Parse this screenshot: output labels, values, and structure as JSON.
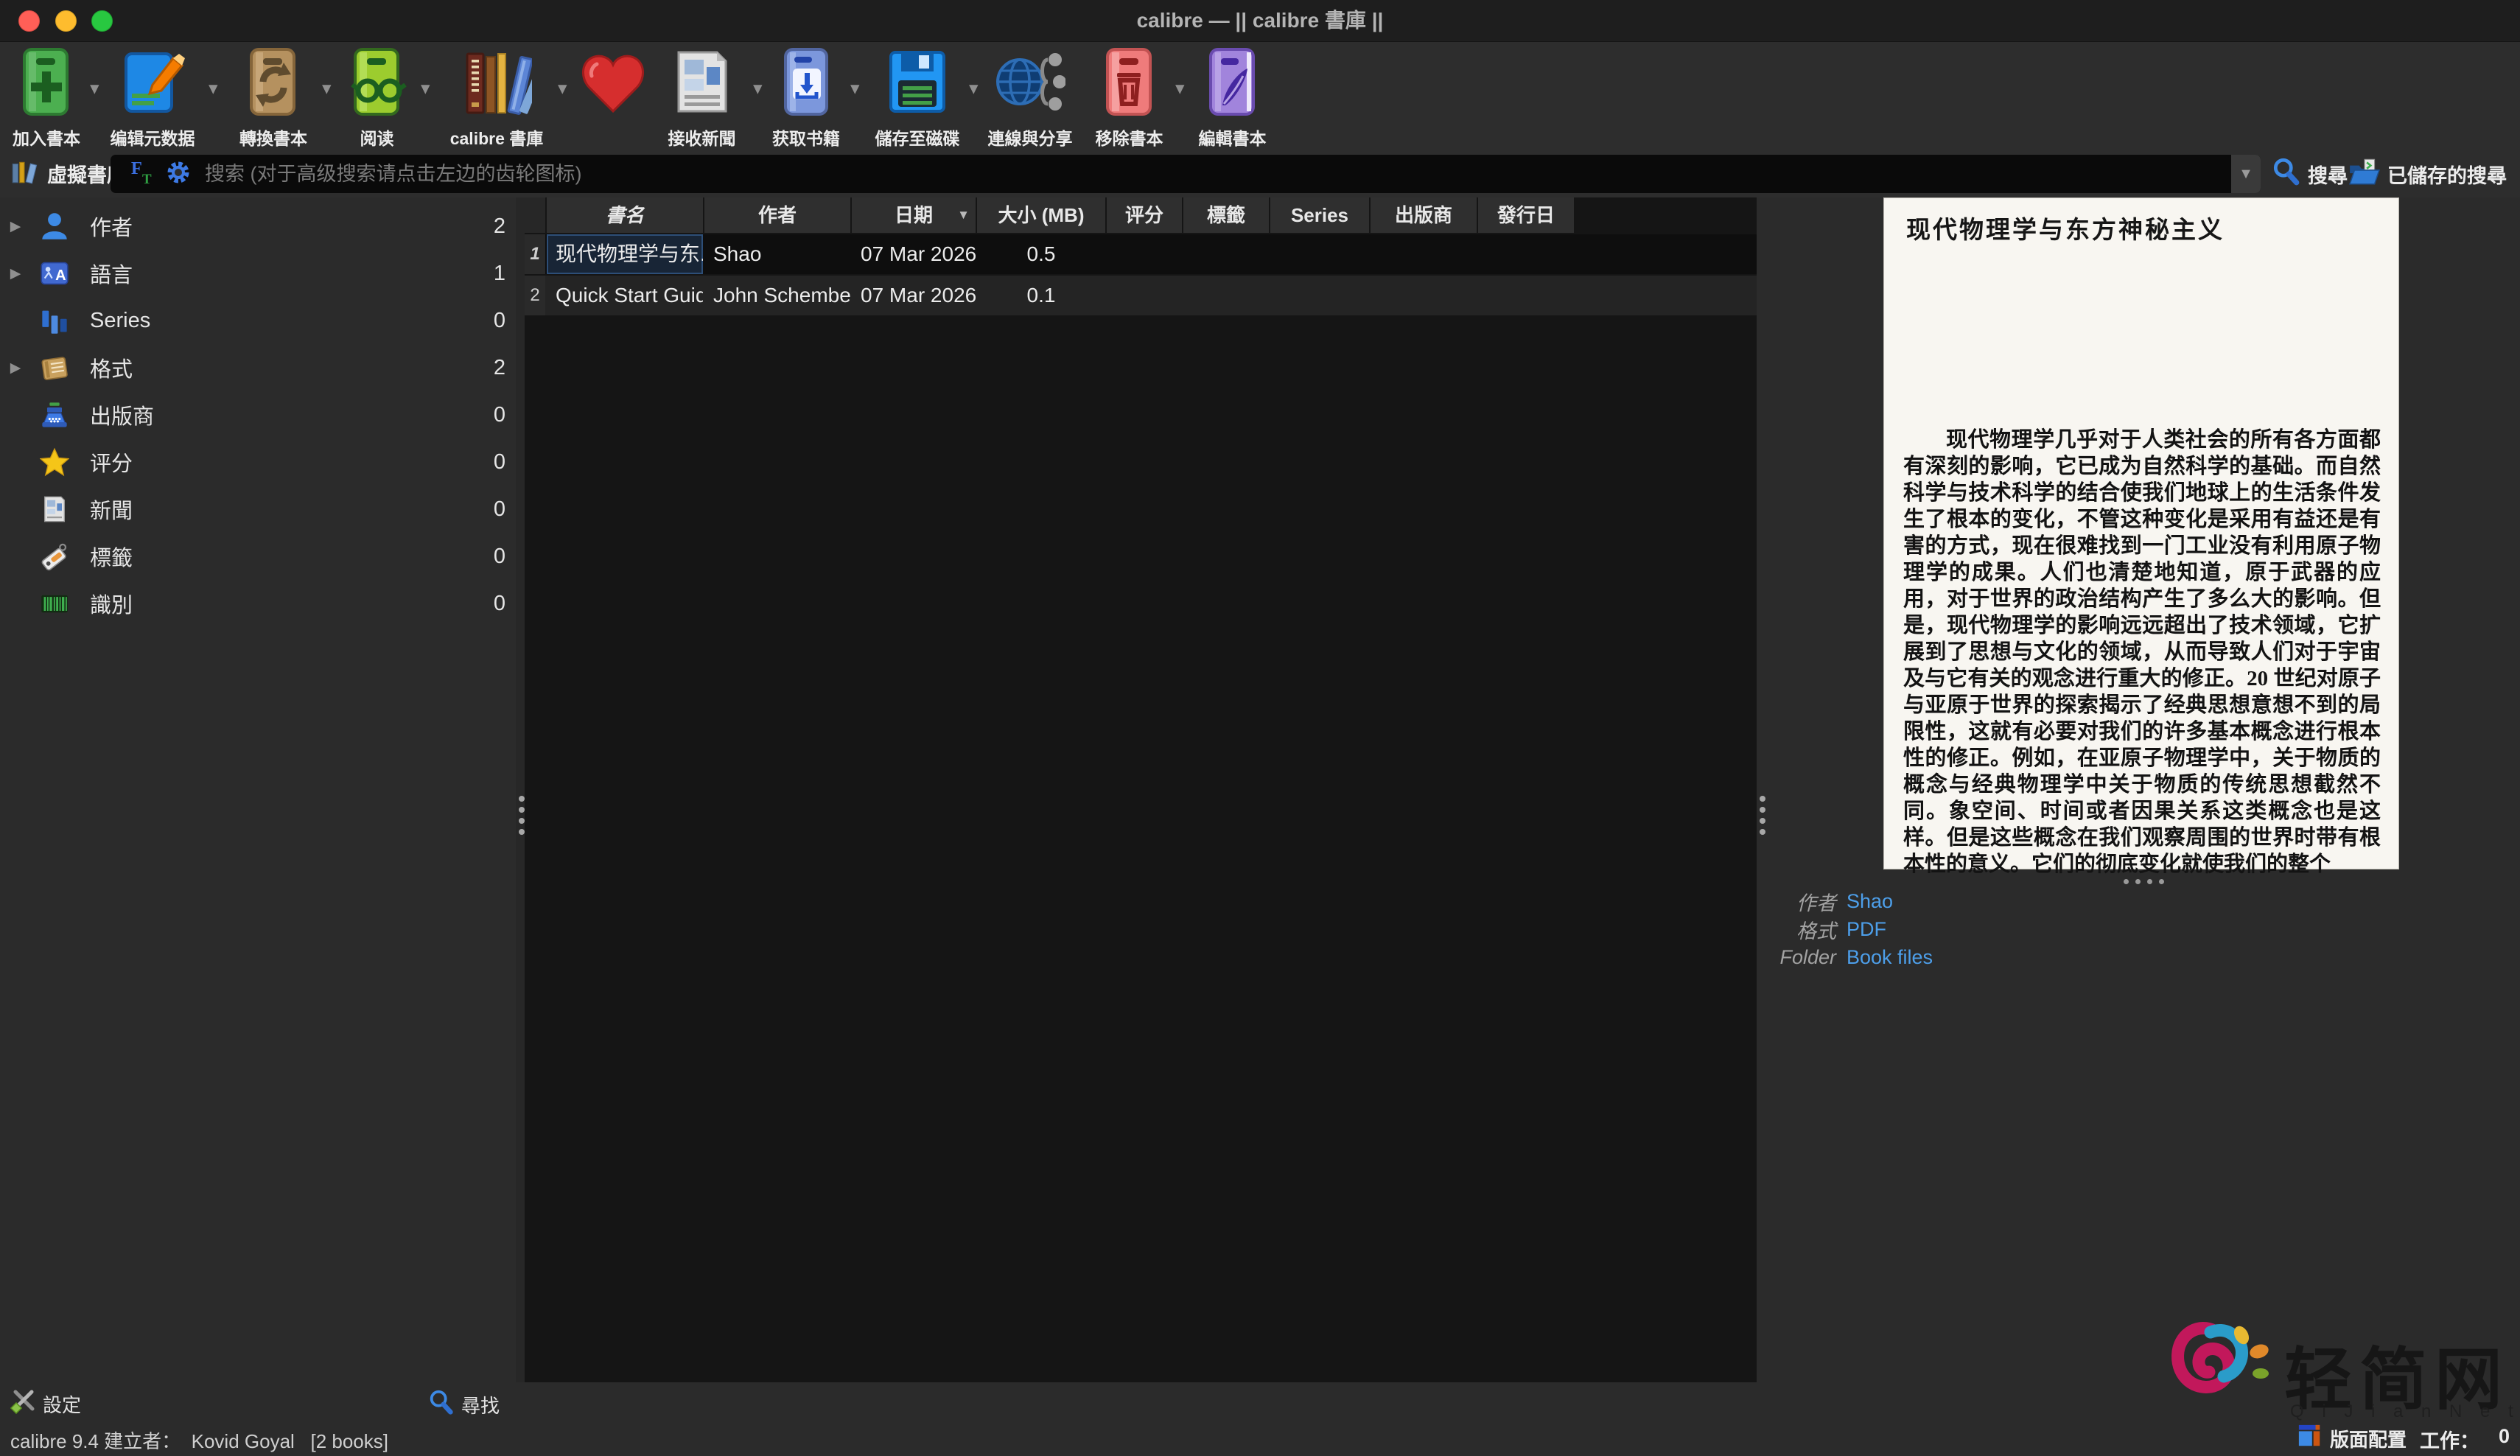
{
  "window": {
    "title": "calibre — || calibre 書庫 ||"
  },
  "toolbar": {
    "items": [
      {
        "label": "加入書本",
        "icon": "add-books-icon",
        "dropdown": true
      },
      {
        "label": "编辑元数据",
        "icon": "edit-metadata-icon",
        "dropdown": true
      },
      {
        "label": "轉換書本",
        "icon": "convert-books-icon",
        "dropdown": true
      },
      {
        "label": "阅读",
        "icon": "view-icon",
        "dropdown": true
      },
      {
        "label": "calibre 書庫",
        "icon": "library-icon",
        "dropdown": true
      },
      {
        "label": "",
        "icon": "donate-heart-icon",
        "dropdown": false
      },
      {
        "label": "接收新聞",
        "icon": "fetch-news-icon",
        "dropdown": true
      },
      {
        "label": "获取书籍",
        "icon": "get-books-icon",
        "dropdown": true
      },
      {
        "label": "儲存至磁碟",
        "icon": "save-to-disk-icon",
        "dropdown": true
      },
      {
        "label": "連線與分享",
        "icon": "connect-share-icon",
        "dropdown": false
      },
      {
        "label": "移除書本",
        "icon": "remove-books-icon",
        "dropdown": true
      },
      {
        "label": "編輯書本",
        "icon": "edit-book-icon",
        "dropdown": false
      }
    ]
  },
  "search": {
    "virtual_library": "虛擬書庫",
    "placeholder": "搜索 (对于高级搜索请点击左边的齿轮图标)",
    "search_label": "搜尋",
    "saved_label": "已儲存的搜尋"
  },
  "sidebar": {
    "items": [
      {
        "label": "作者",
        "count": "2",
        "expandable": true
      },
      {
        "label": "語言",
        "count": "1",
        "expandable": true
      },
      {
        "label": "Series",
        "count": "0",
        "expandable": false
      },
      {
        "label": "格式",
        "count": "2",
        "expandable": true
      },
      {
        "label": "出版商",
        "count": "0",
        "expandable": false
      },
      {
        "label": "评分",
        "count": "0",
        "expandable": false
      },
      {
        "label": "新聞",
        "count": "0",
        "expandable": false
      },
      {
        "label": "標籤",
        "count": "0",
        "expandable": false
      },
      {
        "label": "識別",
        "count": "0",
        "expandable": false
      }
    ]
  },
  "book_list": {
    "columns": [
      "書名",
      "作者",
      "日期",
      "大小 (MB)",
      "评分",
      "標籤",
      "Series",
      "出版商",
      "發行日"
    ],
    "sort_column": "日期",
    "rows": [
      {
        "num": "1",
        "title": "现代物理学与东...",
        "author": "Shao",
        "date": "07 Mar 2026",
        "size": "0.5"
      },
      {
        "num": "2",
        "title": "Quick Start Guide",
        "author": "John Schember",
        "date": "07 Mar 2026",
        "size": "0.1"
      }
    ]
  },
  "details": {
    "cover_title": "现代物理学与东方神秘主义",
    "cover_text": "现代物理学几乎对于人类社会的所有各方面都有深刻的影响，它已成为自然科学的基础。而自然科学与技术科学的结合使我们地球上的生活条件发生了根本的变化，不管这种变化是采用有益还是有害的方式，现在很难找到一门工业没有利用原子物理学的成果。人们也清楚地知道，原于武器的应用，对于世界的政治结构产生了多么大的影响。但是，现代物理学的影响远远超出了技术领域，它扩展到了思想与文化的领域，从而导致人们对于宇宙及与它有关的观念进行重大的修正。20 世纪对原子与亚原于世界的探索揭示了经典思想意想不到的局限性，这就有必要对我们的许多基本概念进行根本性的修正。例如，在亚原子物理学中，关于物质的概念与经典物理学中关于物质的传统思想截然不同。象空间、时间或者因果关系这类概念也是这样。但是这些概念在我们观察周围的世界时带有根本性的意义。它们的彻底变化就使我们的整个",
    "fields": [
      {
        "label": "作者",
        "value": "Shao"
      },
      {
        "label": "格式",
        "value": "PDF"
      },
      {
        "label": "Folder",
        "value": "Book files"
      }
    ]
  },
  "tag_footer": {
    "settings": "設定",
    "find": "尋找"
  },
  "status": {
    "left": "calibre 9.4 建立者：  Kovid Goyal   [2 books]",
    "layout": "版面配置",
    "jobs_label": "工作：",
    "jobs_count": "0"
  },
  "watermark": {
    "title": "轻简网",
    "subtitle": "Q i J i a n N e t"
  },
  "colors": {
    "accent_blue": "#3d8ae5",
    "link_blue": "#4d9fea",
    "selection_border": "#2d4e77",
    "cover_bg": "#f8f6f1",
    "watermark_magenta": "#c2185b",
    "watermark_blue": "#2a9cc9"
  }
}
